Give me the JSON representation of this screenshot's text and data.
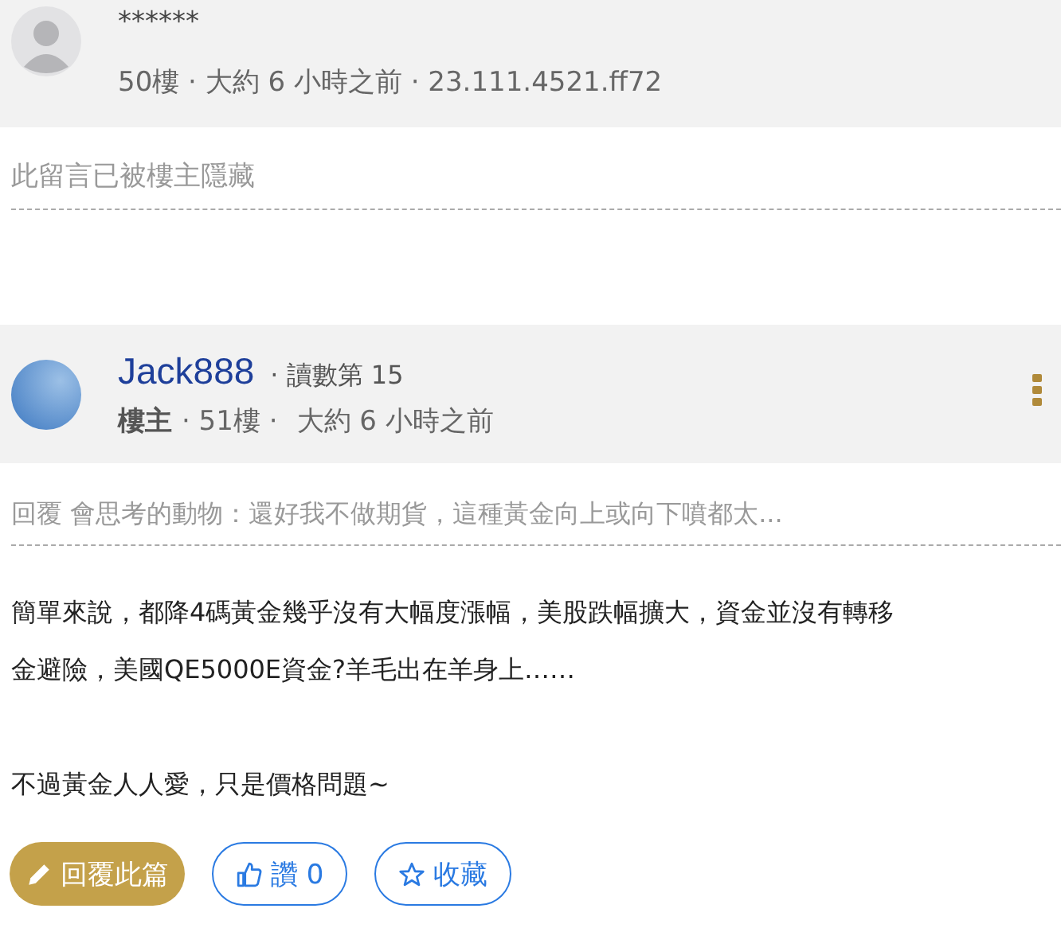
{
  "hidden_post": {
    "avatar": {
      "kind": "default"
    },
    "author": "******",
    "meta": "50樓 · 大約 6 小時之前 · 23.111.4521.ff72",
    "notice": "此留言已被樓主隱藏"
  },
  "post": {
    "avatar": {
      "kind": "photo"
    },
    "author": "Jack888",
    "reads": "· 讀數第 15",
    "role": "樓主",
    "floor": "· 51樓 ·",
    "time": "大約 6 小時之前",
    "reply_to": "回覆 會思考的動物：還好我不做期貨，這種黃金向上或向下噴都太...",
    "paragraphs": [
      [
        "簡單來說，都降4碼黃金幾乎沒有大幅度漲幅，美股跌幅擴大，資金並沒有轉移",
        "金避險，美國QE5000E資金?羊毛出在羊身上……"
      ],
      [
        "不過黃金人人愛，只是價格問題~"
      ]
    ],
    "actions": [
      {
        "kind": "reply",
        "label": "回覆此篇"
      },
      {
        "kind": "like",
        "label": "讚 0"
      },
      {
        "kind": "bookmark",
        "label": "收藏"
      }
    ]
  }
}
